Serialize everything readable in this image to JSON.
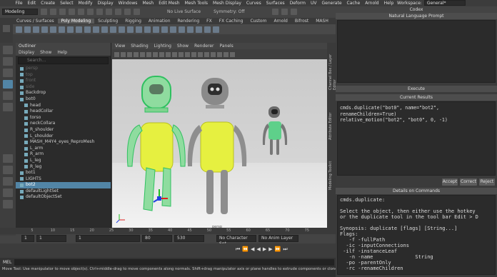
{
  "menubar": {
    "items": [
      "File",
      "Edit",
      "Create",
      "Select",
      "Modify",
      "Display",
      "Windows",
      "Mesh",
      "Edit Mesh",
      "Mesh Tools",
      "Mesh Display",
      "Curves",
      "Surfaces",
      "Deform",
      "UV",
      "Generate",
      "Cache",
      "Arnold",
      "Help"
    ],
    "workspace_label": "Workspace:",
    "workspace_value": "General*"
  },
  "statusline": {
    "mode": "Modeling",
    "live_surface": "No Live Surface",
    "symmetry": "Symmetry: Off"
  },
  "shelf": {
    "tabs": [
      "Curves / Surfaces",
      "Poly Modeling",
      "Sculpting",
      "Rigging",
      "Animation",
      "Rendering",
      "FX",
      "FX Caching",
      "Custom",
      "Arnold",
      "Bifrost",
      "MASH"
    ],
    "active_tab": 1
  },
  "outliner": {
    "title": "Outliner",
    "menu": [
      "Display",
      "Show",
      "Help"
    ],
    "search_placeholder": "Search...",
    "rows": [
      {
        "label": "persp",
        "indent": 1,
        "dim": true
      },
      {
        "label": "top",
        "indent": 1,
        "dim": true
      },
      {
        "label": "front",
        "indent": 1,
        "dim": true
      },
      {
        "label": "side",
        "indent": 1,
        "dim": true
      },
      {
        "label": "Backdrop",
        "indent": 1,
        "dim": false
      },
      {
        "label": "bot0",
        "indent": 1,
        "dim": false
      },
      {
        "label": "head",
        "indent": 2,
        "dim": false
      },
      {
        "label": "headCollar",
        "indent": 2,
        "dim": false
      },
      {
        "label": "torso",
        "indent": 2,
        "dim": false
      },
      {
        "label": "neckCollara",
        "indent": 2,
        "dim": false
      },
      {
        "label": "R_shoulder",
        "indent": 2,
        "dim": false
      },
      {
        "label": "L_shoulder",
        "indent": 2,
        "dim": false
      },
      {
        "label": "MASH_M4Y4_eyes_ReproMesh",
        "indent": 2,
        "dim": false
      },
      {
        "label": "L_arm",
        "indent": 2,
        "dim": false
      },
      {
        "label": "R_arm",
        "indent": 2,
        "dim": false
      },
      {
        "label": "L_leg",
        "indent": 2,
        "dim": false
      },
      {
        "label": "R_leg",
        "indent": 2,
        "dim": false
      },
      {
        "label": "bot1",
        "indent": 1,
        "dim": false
      },
      {
        "label": "LIGHTS",
        "indent": 1,
        "dim": false
      },
      {
        "label": "bot2",
        "indent": 1,
        "dim": false,
        "selected": true
      },
      {
        "label": "defaultLightSet",
        "indent": 1,
        "dim": false
      },
      {
        "label": "defaultObjectSet",
        "indent": 1,
        "dim": false
      }
    ]
  },
  "viewport": {
    "menu": [
      "View",
      "Shading",
      "Lighting",
      "Show",
      "Renderer",
      "Panels"
    ],
    "camera_label": "persp",
    "colors": {
      "green_wire": "#3cd070",
      "yellow_body": "#e6f040",
      "grey_body": "#8e8e8e",
      "teal_torso": "#5ed08a"
    }
  },
  "side_tabs": [
    "Channel Box / Layer Editor",
    "Attribute Editor",
    "Modeling Toolkit"
  ],
  "codex": {
    "title": "Codex",
    "nl_prompt_header": "Natural Language Prompt",
    "execute_label": "Execute",
    "current_results_header": "Current Results",
    "result_code": "cmds.duplicate(\"bot0\", name=\"bot2\",\nrenameChildren=True)\nrelative_motion(\"bot2\", \"bot0\", 0, -1)",
    "buttons": {
      "accept": "Accept",
      "correct": "Correct",
      "reject": "Reject"
    },
    "details_header": "Details on Commands",
    "details_text": "cmds.duplicate:\n\nSelect the object, then either use the hotkey\nor the duplicate tool in the tool bar Edit > D\n\nSynopsis: duplicate [flags] [String...]\nFlags:\n   -f -fullPath\n  -ic -inputConnections\n -ilf -instanceLeaf\n   -n -name              String\n  -po -parentOnly\n  -rc -renameChildren"
  },
  "timeline": {
    "ticks": [
      "5",
      "10",
      "15",
      "20",
      "25",
      "30",
      "35",
      "40",
      "45",
      "50",
      "55",
      "60",
      "65",
      "70",
      "75"
    ],
    "range_start": "1",
    "range_inner_start": "1",
    "range_field": "1",
    "range_end": "80",
    "range_outer_end": "530",
    "character_set": "No Character Set",
    "anim_layer": "No Anim Layer",
    "fps": "24 fps"
  },
  "command_line": {
    "label": "MEL"
  },
  "help_line": "Move Tool: Use manipulator to move object(s). Ctrl+middle-drag to move components along normals. Shift+drag manipulator axis or plane handles to extrude components or clone ol"
}
